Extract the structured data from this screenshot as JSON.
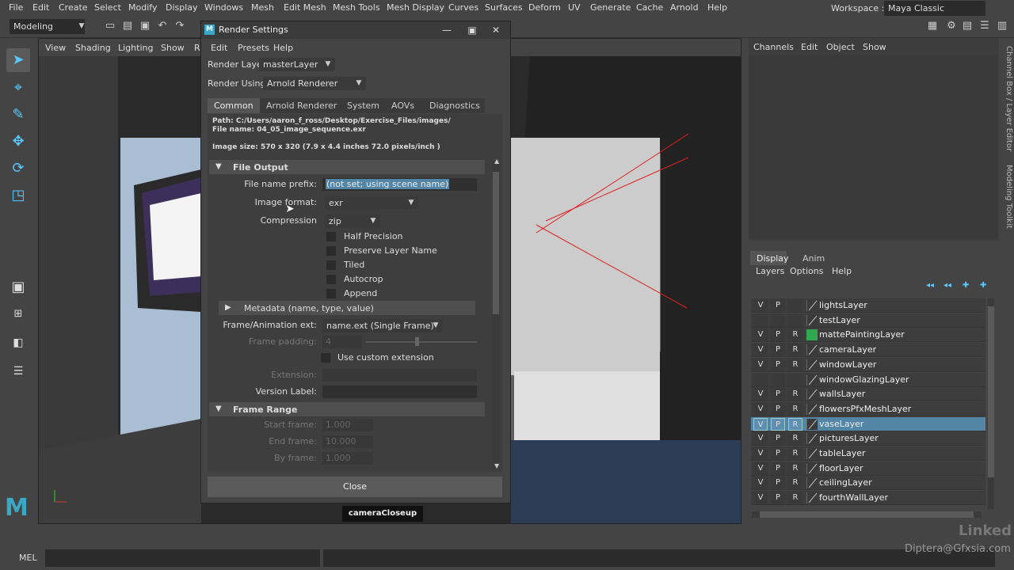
{
  "menubar": [
    "File",
    "Edit",
    "Create",
    "Select",
    "Modify",
    "Display",
    "Windows",
    "Mesh",
    "Edit Mesh",
    "Mesh Tools",
    "Mesh Display",
    "Curves",
    "Surfaces",
    "Deform",
    "UV",
    "Generate",
    "Cache",
    "Arnold",
    "Help"
  ],
  "workspace": {
    "label": "Workspace :",
    "value": "Maya Classic"
  },
  "mode": "Modeling",
  "viewport": {
    "menu": [
      "View",
      "Shading",
      "Lighting",
      "Show",
      "R"
    ],
    "camera": "cameraCloseup"
  },
  "channel_box": {
    "menu": [
      "Channels",
      "Edit",
      "Object",
      "Show"
    ]
  },
  "side_tabs": [
    "Channel Box / Layer Editor",
    "Modeling Toolkit"
  ],
  "layer_editor": {
    "tabs": [
      "Display",
      "Anim"
    ],
    "menu": [
      "Layers",
      "Options",
      "Help"
    ],
    "layers": [
      {
        "v": "V",
        "p": "P",
        "r": "",
        "name": "lightsLayer",
        "color": ""
      },
      {
        "v": "",
        "p": "",
        "r": "",
        "name": "testLayer",
        "color": ""
      },
      {
        "v": "V",
        "p": "P",
        "r": "R",
        "name": "mattePaintingLayer",
        "color": "#2fa84f"
      },
      {
        "v": "V",
        "p": "P",
        "r": "R",
        "name": "cameraLayer",
        "color": ""
      },
      {
        "v": "V",
        "p": "P",
        "r": "R",
        "name": "windowLayer",
        "color": ""
      },
      {
        "v": "",
        "p": "",
        "r": "",
        "name": "windowGlazingLayer",
        "color": ""
      },
      {
        "v": "V",
        "p": "P",
        "r": "R",
        "name": "wallsLayer",
        "color": ""
      },
      {
        "v": "V",
        "p": "P",
        "r": "R",
        "name": "flowersPfxMeshLayer",
        "color": ""
      },
      {
        "v": "V",
        "p": "P",
        "r": "R",
        "name": "vaseLayer",
        "color": "",
        "selected": true
      },
      {
        "v": "V",
        "p": "P",
        "r": "R",
        "name": "picturesLayer",
        "color": ""
      },
      {
        "v": "V",
        "p": "P",
        "r": "R",
        "name": "tableLayer",
        "color": ""
      },
      {
        "v": "V",
        "p": "P",
        "r": "R",
        "name": "floorLayer",
        "color": ""
      },
      {
        "v": "V",
        "p": "P",
        "r": "R",
        "name": "ceilingLayer",
        "color": ""
      },
      {
        "v": "V",
        "p": "P",
        "r": "R",
        "name": "fourthWallLayer",
        "color": ""
      }
    ]
  },
  "render_settings": {
    "title": "Render Settings",
    "menu": [
      "Edit",
      "Presets",
      "Help"
    ],
    "render_layer_label": "Render Layer",
    "render_layer": "masterLayer",
    "render_using_label": "Render Using",
    "render_using": "Arnold Renderer",
    "tabs": [
      "Common",
      "Arnold Renderer",
      "System",
      "AOVs",
      "Diagnostics"
    ],
    "path": "Path: C:/Users/aaron_f_ross/Desktop/Exercise_Files/images/",
    "file_name": "File name:  04_05_image_sequence.exr",
    "image_size": "Image size: 570 x 320 (7.9 x 4.4 inches 72.0 pixels/inch )",
    "file_output": {
      "title": "File Output",
      "prefix_label": "File name prefix:",
      "prefix_value": "(not set; using scene name)",
      "format_label": "Image format:",
      "format_value": "exr",
      "compression_label": "Compression",
      "compression_value": "zip",
      "checkboxes": [
        "Half Precision",
        "Preserve Layer Name",
        "Tiled",
        "Autocrop",
        "Append"
      ],
      "metadata": "Metadata (name, type, value)",
      "frame_ext_label": "Frame/Animation ext:",
      "frame_ext_value": "name.ext (Single Frame)",
      "padding_label": "Frame padding:",
      "padding_value": "4",
      "custom_ext_label": "Use custom extension",
      "extension_label": "Extension:",
      "version_label": "Version Label:"
    },
    "frame_range": {
      "title": "Frame Range",
      "start_label": "Start frame:",
      "start": "1.000",
      "end_label": "End frame:",
      "end": "10.000",
      "by_label": "By frame:",
      "by": "1.000"
    },
    "close": "Close"
  },
  "command_line": {
    "label": "MEL"
  },
  "watermark": "Diptera@Gfxsia.com",
  "brand": "Linked"
}
